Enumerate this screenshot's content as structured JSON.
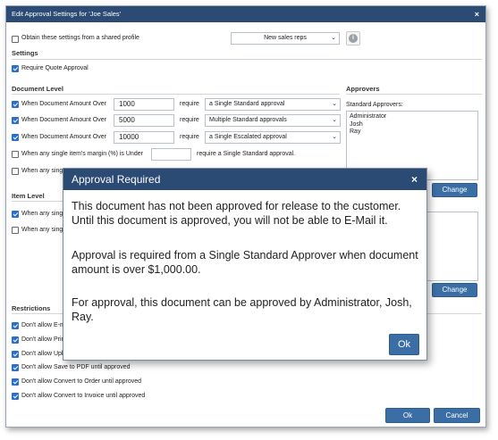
{
  "dialog": {
    "title": "Edit Approval Settings for 'Joe Sales'",
    "close_glyph": "×"
  },
  "shared_profile": {
    "label": "Obtain these settings from a shared profile",
    "checked": false,
    "profile_value": "New sales reps"
  },
  "settings": {
    "heading": "Settings",
    "require_quote_approval_label": "Require Quote Approval",
    "require_quote_approval_checked": true
  },
  "document_level": {
    "heading": "Document Level",
    "rows": [
      {
        "label": "When Document Amount Over",
        "checked": true,
        "amount": "1000",
        "require": "require",
        "approval": "a Single Standard approval"
      },
      {
        "label": "When Document Amount Over",
        "checked": true,
        "amount": "5000",
        "require": "require",
        "approval": "Multiple Standard approvals"
      },
      {
        "label": "When Document Amount Over",
        "checked": true,
        "amount": "10000",
        "require": "require",
        "approval": "a Single Escalated approval"
      }
    ],
    "margin_row": {
      "label": "When any single item's margin (%) is Under",
      "checked": false,
      "value": "",
      "suffix": "require a Single Standard approval."
    },
    "partial_row": {
      "label": "When any sing",
      "checked": false
    }
  },
  "approvers": {
    "heading": "Approvers",
    "standard_label": "Standard Approvers:",
    "standard_list": [
      "Administrator",
      "Josh",
      "Ray"
    ],
    "change_label": "Change",
    "change2_label": "Change"
  },
  "item_level": {
    "heading": "Item Level",
    "rows": [
      {
        "label": "When any sing",
        "checked": true
      },
      {
        "label": "When any sing",
        "checked": false
      }
    ]
  },
  "restrictions": {
    "heading": "Restrictions",
    "rows": [
      {
        "label": "Don't allow E-m",
        "checked": true
      },
      {
        "label": "Don't allow Prin",
        "checked": true
      },
      {
        "label": "Don't allow Upl",
        "checked": true
      },
      {
        "label": "Don't allow Save to PDF until approved",
        "checked": true
      },
      {
        "label": "Don't allow Convert to Order until approved",
        "checked": true
      },
      {
        "label": "Don't allow Convert to Invoice until approved",
        "checked": true
      }
    ]
  },
  "footer": {
    "ok_label": "Ok",
    "cancel_label": "Cancel"
  },
  "modal": {
    "title": "Approval Required",
    "close_glyph": "×",
    "paragraph1": "This document has not been approved for release to the customer. Until this document is approved, you will not be able to E-Mail it.",
    "paragraph2": "Approval is required from a Single Standard Approver when document amount is over $1,000.00.",
    "paragraph3": "For approval, this document can be approved by Administrator, Josh, Ray.",
    "ok_label": "Ok"
  },
  "colors": {
    "titlebar": "#2b4a74",
    "button": "#3a6ea5",
    "checkbox_checked": "#2a6fcf"
  },
  "icons": {
    "info": "info-icon",
    "close": "close-icon",
    "dropdown": "chevron-down-icon"
  }
}
